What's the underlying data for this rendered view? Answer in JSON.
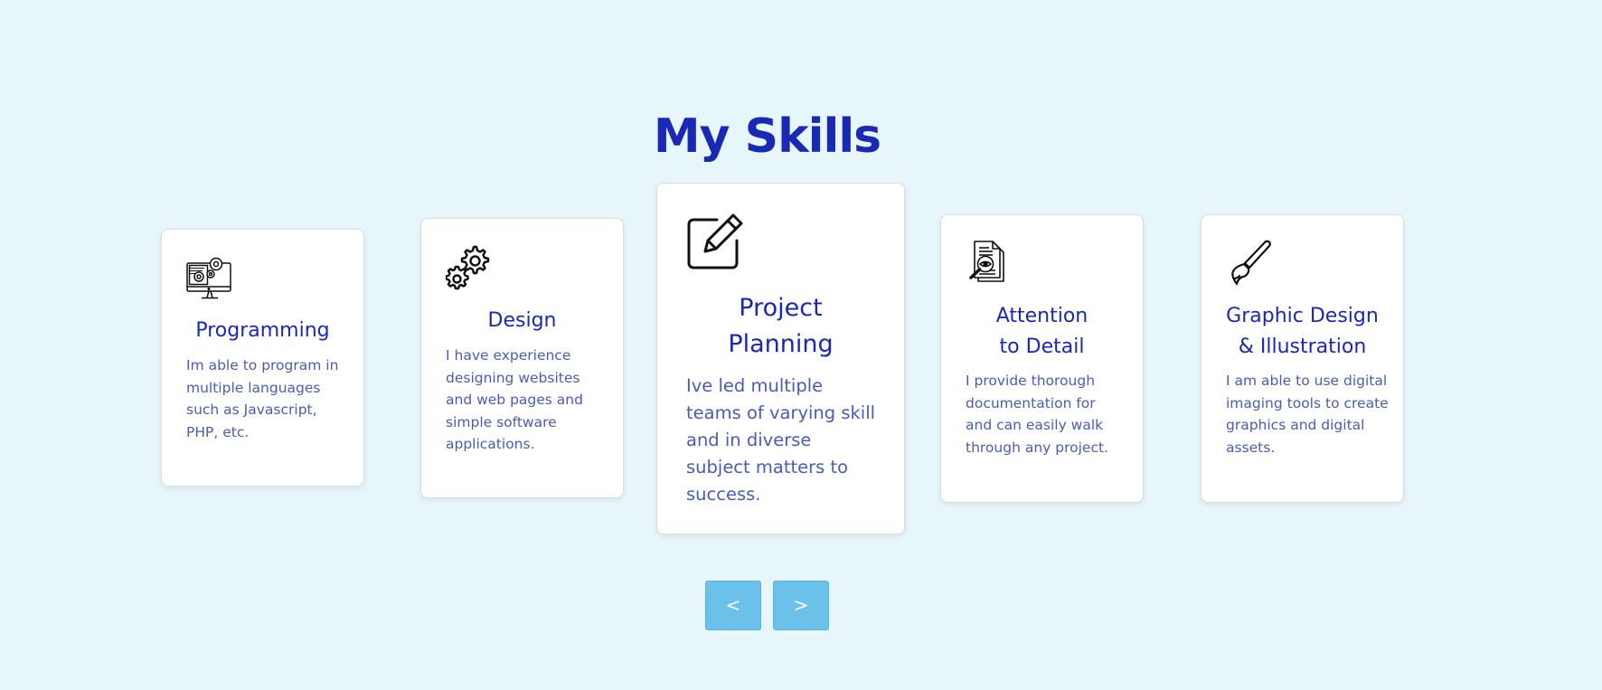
{
  "title": "My Skills",
  "cards": [
    {
      "icon": "computer-gears-icon",
      "title_lines": [
        "Programming"
      ],
      "description": "Im able to program in multiple languages such as Javascript, PHP, etc."
    },
    {
      "icon": "gears-icon",
      "title_lines": [
        "Design"
      ],
      "description": "I have experience designing websites and web pages and simple software applications."
    },
    {
      "icon": "edit-pencil-icon",
      "title_lines": [
        "Project",
        "Planning"
      ],
      "description": "Ive led multiple teams of varying skill and in diverse subject matters to success."
    },
    {
      "icon": "document-inspect-icon",
      "title_lines": [
        "Attention",
        "to Detail"
      ],
      "description": "I provide thorough documentation for and can easily walk through any project."
    },
    {
      "icon": "paintbrush-icon",
      "title_lines": [
        "Graphic Design",
        "& Illustration"
      ],
      "description": "I am able to use digital imaging tools to create graphics and digital assets."
    }
  ],
  "carousel": {
    "prev_label": "<",
    "next_label": ">"
  },
  "colors": {
    "background": "#e6f6fa",
    "heading": "#1a29b5",
    "body_text": "#4b5bba",
    "button": "#6cc1ea"
  }
}
